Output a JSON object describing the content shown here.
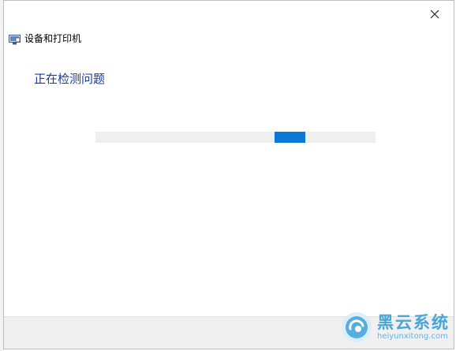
{
  "window": {
    "title": "设备和打印机",
    "close_icon": "close-icon",
    "app_icon": "devices-printers-icon"
  },
  "main": {
    "heading": "正在检测问题",
    "progress": {
      "state": "indeterminate",
      "chunk_position_fraction": 0.64,
      "chunk_width_fraction": 0.11,
      "track_color": "#efefef",
      "chunk_color": "#0a78d7"
    }
  },
  "watermark": {
    "name": "黑云系统",
    "url": "heiyunxitong.com",
    "icon": "heiyun-logo-icon",
    "color": "#3a9fd6"
  },
  "colors": {
    "heading": "#1a3a9c",
    "footer": "#f0f0f0"
  }
}
